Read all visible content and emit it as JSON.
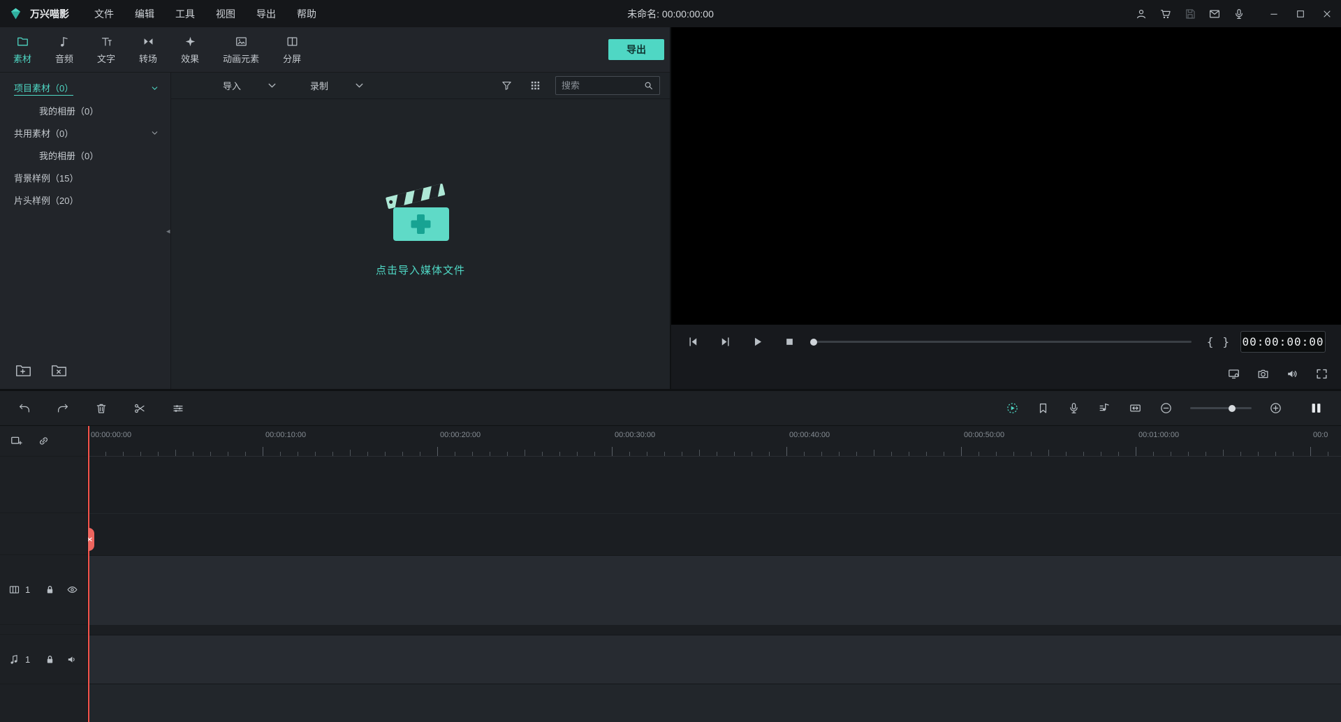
{
  "colors": {
    "accent": "#4fd7c4",
    "playhead": "#f4524a",
    "panel_bg": "#22252a"
  },
  "titlebar": {
    "app_name": "万兴喵影",
    "menus": [
      "文件",
      "编辑",
      "工具",
      "视图",
      "导出",
      "帮助"
    ],
    "document_title": "未命名: 00:00:00:00"
  },
  "tabs": [
    {
      "label": "素材"
    },
    {
      "label": "音频"
    },
    {
      "label": "文字"
    },
    {
      "label": "转场"
    },
    {
      "label": "效果"
    },
    {
      "label": "动画元素"
    },
    {
      "label": "分屏"
    }
  ],
  "export_button_label": "导出",
  "sidebar": {
    "items": [
      {
        "label": "项目素材（0）"
      },
      {
        "label": "我的相册（0）"
      },
      {
        "label": "共用素材（0）"
      },
      {
        "label": "我的相册（0）"
      },
      {
        "label": "背景样例（15）"
      },
      {
        "label": "片头样例（20）"
      }
    ]
  },
  "media": {
    "import_label": "导入",
    "record_label": "录制",
    "search_placeholder": "搜索",
    "empty_hint": "点击导入媒体文件"
  },
  "preview": {
    "timecode": "00:00:00:00",
    "mark_in": "{",
    "mark_out": "}"
  },
  "timeline": {
    "ruler_labels": [
      "00:00:00:00",
      "00:00:10:00",
      "00:00:20:00",
      "00:00:30:00",
      "00:00:40:00",
      "00:00:50:00",
      "00:01:00:00",
      "00:0"
    ],
    "video_track_number": "1",
    "audio_track_number": "1"
  }
}
